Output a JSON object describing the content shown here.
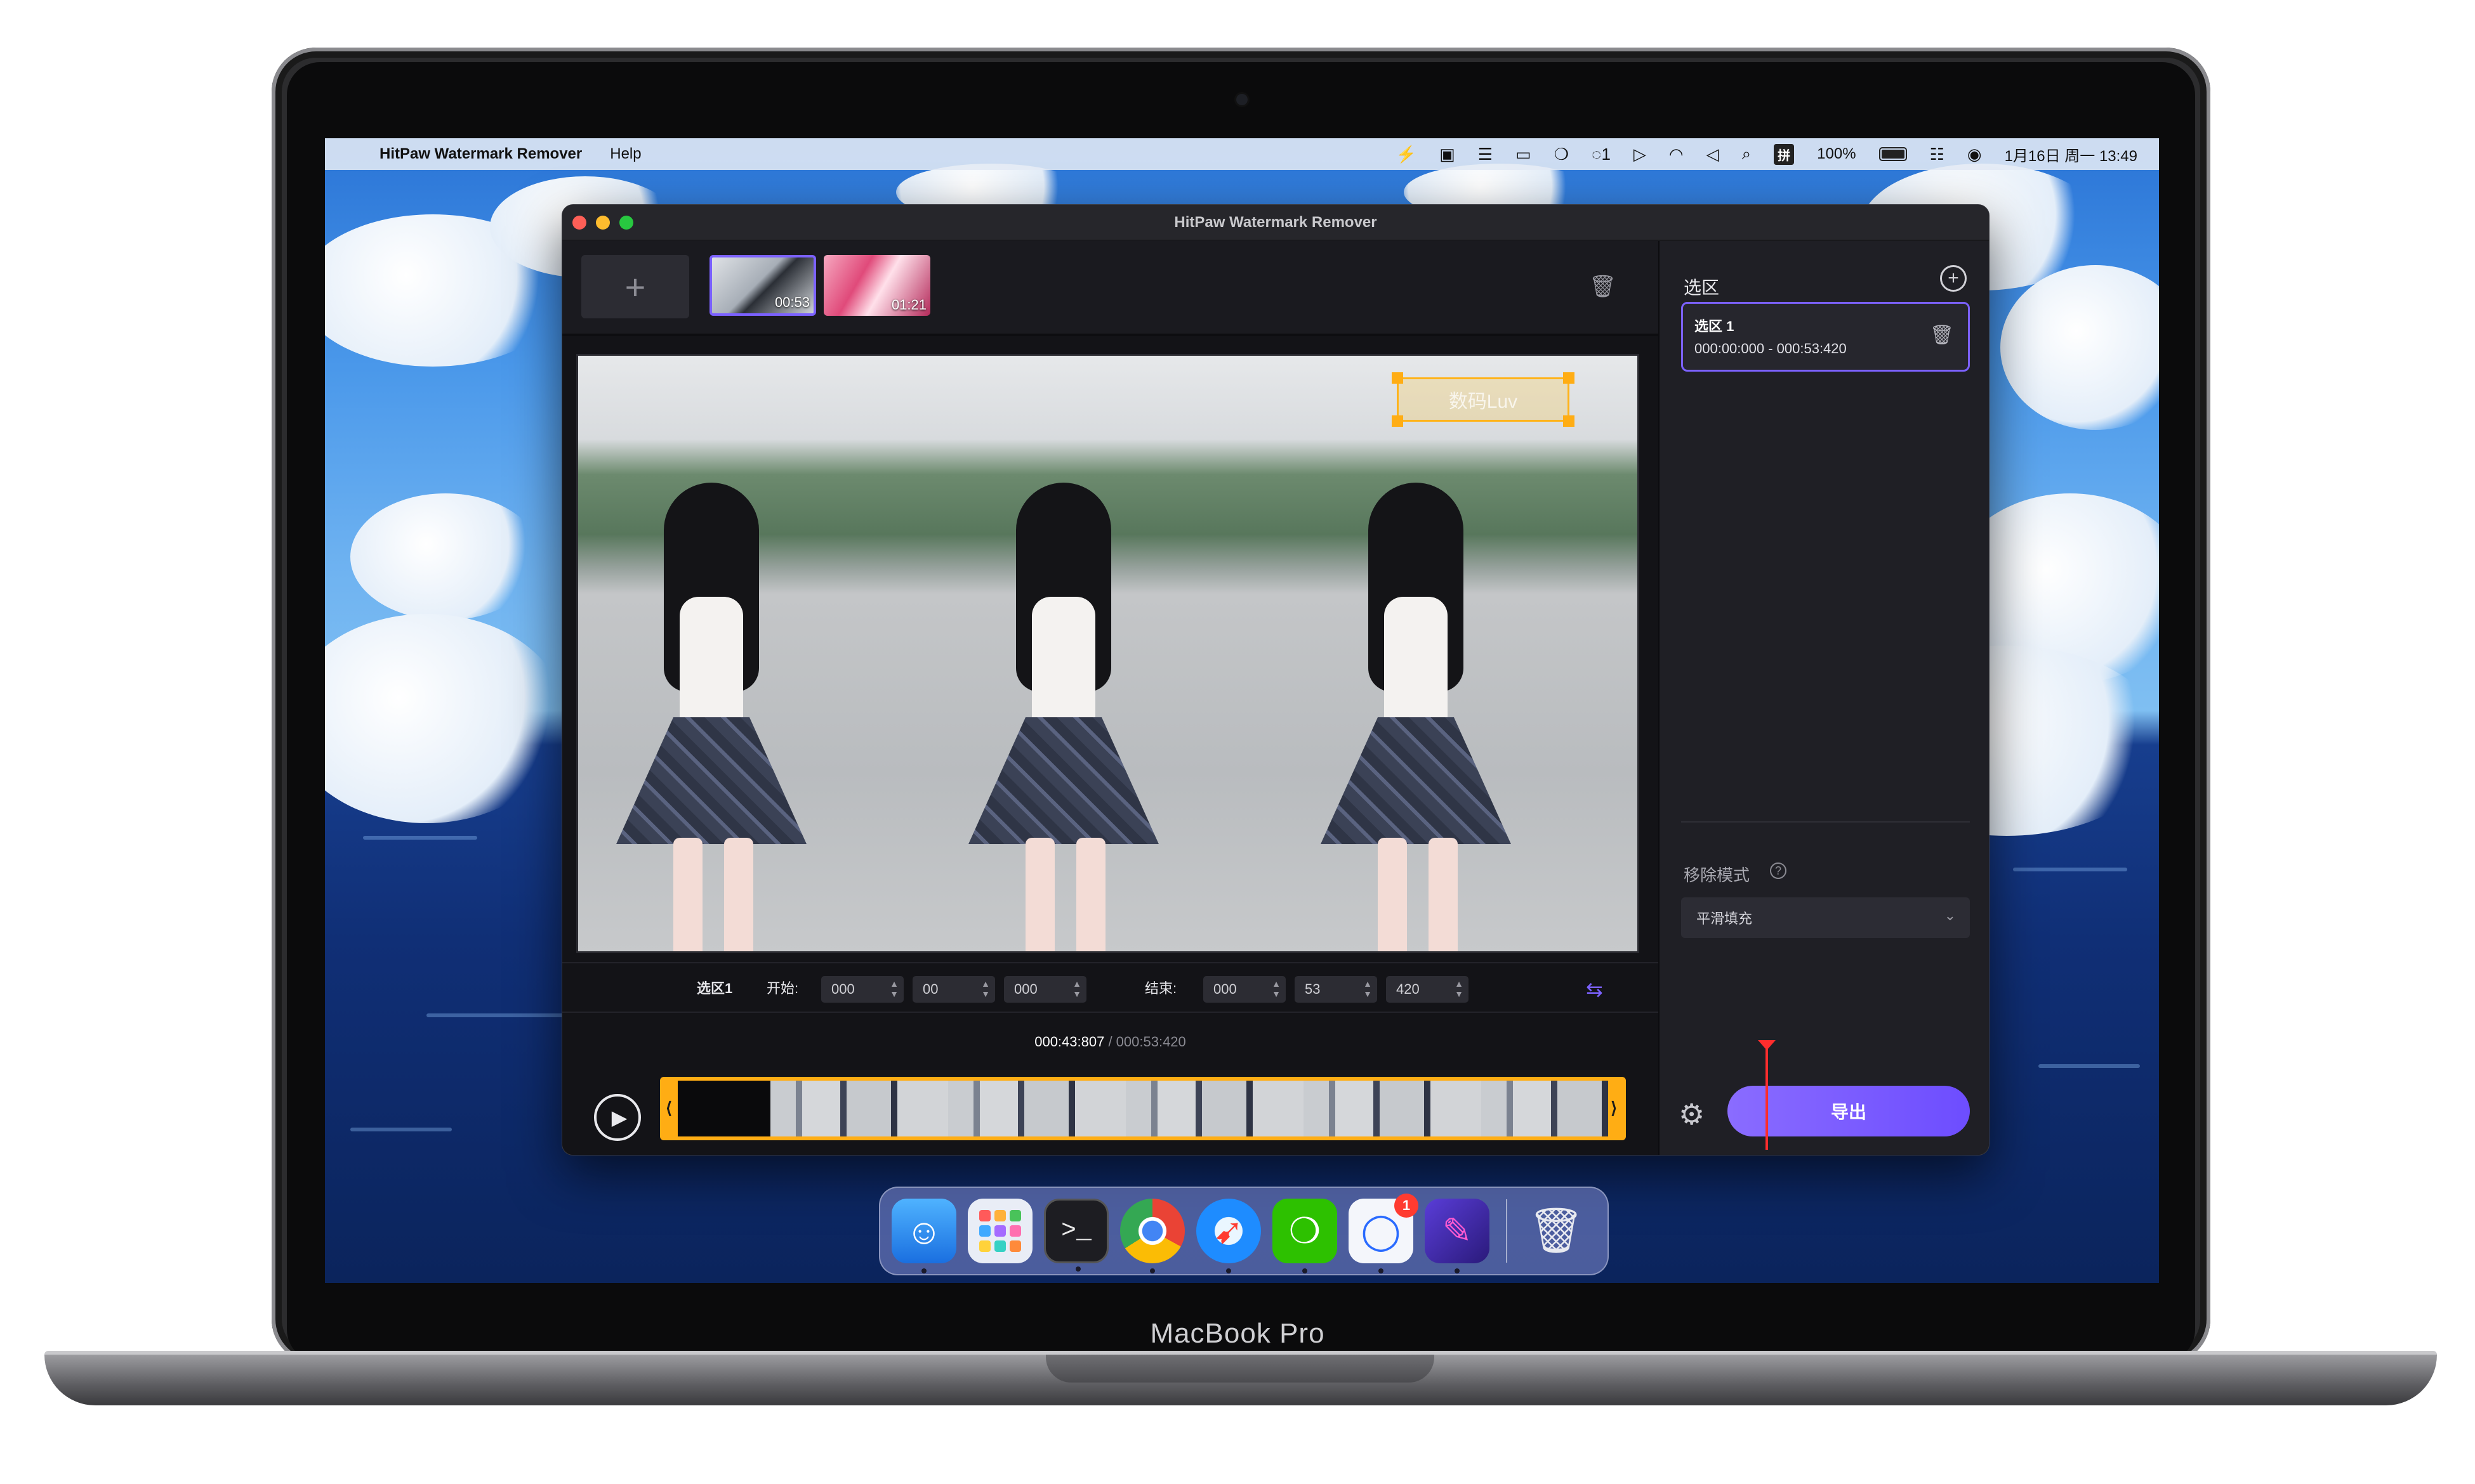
{
  "device": {
    "model_label": "MacBook Pro"
  },
  "menubar": {
    "app_name": "HitPaw Watermark Remover",
    "menu_help": "Help",
    "input_method": "拼",
    "battery_percent": "100%",
    "datetime": "1月16日 周一 13:49",
    "notification_count": "1",
    "icons": [
      "apple-icon",
      "bolt-icon",
      "image-icon",
      "toggle-icon",
      "display-icon",
      "wechat-icon",
      "chat-icon",
      "play-circle-icon",
      "wifi-icon",
      "volume-icon",
      "search-icon",
      "control-center-icon",
      "siri-icon"
    ]
  },
  "window": {
    "title": "HitPaw Watermark Remover"
  },
  "thumbnails": [
    {
      "duration": "00:53",
      "selected": true
    },
    {
      "duration": "01:21",
      "selected": false
    }
  ],
  "preview": {
    "watermark_text": "数码Luv"
  },
  "time_controls": {
    "selection_label": "选区1",
    "start_label": "开始:",
    "end_label": "结束:",
    "start": {
      "a": "000",
      "b": "00",
      "c": "000"
    },
    "end": {
      "a": "000",
      "b": "53",
      "c": "420"
    }
  },
  "timeline": {
    "current": "000:43:807",
    "separator": " / ",
    "total": "000:53:420"
  },
  "sidebar": {
    "title": "选区",
    "selection": {
      "name": "选区 1",
      "range": "000:00:000 - 000:53:420"
    },
    "removal_mode_label": "移除模式",
    "removal_mode_value": "平滑填充",
    "export_label": "导出"
  },
  "dock": {
    "items": [
      {
        "name": "finder",
        "running": true
      },
      {
        "name": "launchpad",
        "running": false
      },
      {
        "name": "terminal",
        "running": true
      },
      {
        "name": "chrome",
        "running": true
      },
      {
        "name": "safari",
        "running": true
      },
      {
        "name": "wechat",
        "running": true
      },
      {
        "name": "messages",
        "running": true,
        "badge": "1"
      },
      {
        "name": "hitpaw",
        "running": true
      },
      {
        "name": "trash",
        "running": false
      }
    ]
  },
  "colors": {
    "accent": "#7b61ff",
    "selection_border": "#ffad14",
    "playhead": "#ff2d2d"
  }
}
